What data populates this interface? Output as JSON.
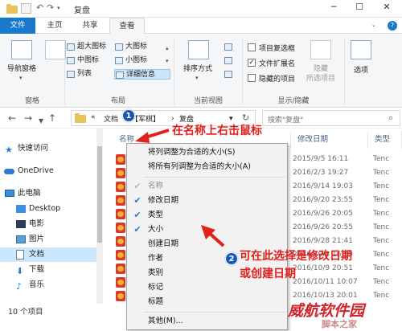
{
  "window": {
    "title": "复盘"
  },
  "ribbon_tabs": [
    {
      "label": "文件"
    },
    {
      "label": "主页"
    },
    {
      "label": "共享"
    },
    {
      "label": "查看"
    }
  ],
  "ribbon": {
    "panes": {
      "nav_pane_label": "导航窗格",
      "group_label": "窗格"
    },
    "layout": {
      "items": [
        "超大图标",
        "大图标",
        "中图标",
        "小图标",
        "列表",
        "详细信息"
      ],
      "group_label": "布局"
    },
    "current_view": {
      "sort_label": "排序方式",
      "group_label": "当前视图"
    },
    "show_hide": {
      "checkboxes": [
        {
          "label": "项目复选框",
          "checked": false
        },
        {
          "label": "文件扩展名",
          "checked": true
        },
        {
          "label": "隐藏的项目",
          "checked": false
        }
      ],
      "hide_selected_label": "隐藏\n所选项目",
      "group_label": "显示/隐藏"
    },
    "options_label": "选项"
  },
  "address": {
    "crumbs": [
      "«",
      "文档",
      "【军棋】",
      "复盘"
    ],
    "search_placeholder": "搜索\"复盘\""
  },
  "sidebar": {
    "items": [
      {
        "label": "快速访问",
        "icon": "star-icon"
      },
      {
        "label": "OneDrive",
        "icon": "cloud-icon"
      },
      {
        "label": "此电脑",
        "icon": "computer-icon"
      },
      {
        "label": "Desktop",
        "icon": "desktop-icon"
      },
      {
        "label": "电影",
        "icon": "movie-icon"
      },
      {
        "label": "图片",
        "icon": "picture-icon"
      },
      {
        "label": "文档",
        "icon": "document-icon"
      },
      {
        "label": "下载",
        "icon": "download-icon"
      },
      {
        "label": "音乐",
        "icon": "music-icon"
      }
    ]
  },
  "filelist": {
    "headers": {
      "name": "名称",
      "date": "修改日期",
      "type": "类型"
    },
    "rows": [
      {
        "date": "2015/9/5 16:11",
        "type": "Tenc"
      },
      {
        "date": "2016/2/3 19:27",
        "type": "Tenc"
      },
      {
        "date": "2016/9/14 19:03",
        "type": "Tenc"
      },
      {
        "date": "2016/9/20 23:55",
        "type": "Tenc"
      },
      {
        "date": "2016/9/26 20:05",
        "type": "Tenc"
      },
      {
        "date": "2016/9/26 20:55",
        "type": "Tenc"
      },
      {
        "date": "2016/9/28 21:41",
        "type": "Tenc"
      },
      {
        "date": "2016/10/8 16:59",
        "type": "Tenc"
      },
      {
        "date": "2016/10/9 20:51",
        "type": "Tenc"
      },
      {
        "date": "2016/10/11 10:07",
        "type": "Tenc"
      },
      {
        "date": "2016/10/13 20:01",
        "type": "Tenc"
      }
    ]
  },
  "status": {
    "count": "10 个项目"
  },
  "context_menu": {
    "items": [
      {
        "label": "将列调整为合适的大小(S)",
        "checked": false,
        "disabled": false
      },
      {
        "label": "将所有列调整为合适的大小(A)",
        "checked": false,
        "disabled": false
      },
      {
        "label": "名称",
        "checked": true,
        "disabled": true
      },
      {
        "label": "修改日期",
        "checked": true,
        "disabled": false
      },
      {
        "label": "类型",
        "checked": true,
        "disabled": false
      },
      {
        "label": "大小",
        "checked": true,
        "disabled": false
      },
      {
        "label": "创建日期",
        "checked": false,
        "disabled": false
      },
      {
        "label": "作者",
        "checked": false,
        "disabled": false
      },
      {
        "label": "类别",
        "checked": false,
        "disabled": false
      },
      {
        "label": "标记",
        "checked": false,
        "disabled": false
      },
      {
        "label": "标题",
        "checked": false,
        "disabled": false
      },
      {
        "label": "其他(M)...",
        "checked": false,
        "disabled": false
      }
    ]
  },
  "annotations": {
    "badge1": "1",
    "badge2": "2",
    "note1": "在名称上右击鼠标",
    "note2_line1": "可在此选择是修改日期",
    "note2_line2": "或创建日期"
  },
  "watermark": {
    "text1": "威航软件园",
    "text2": "脚本之家"
  },
  "colors": {
    "accent": "#1979ca",
    "annotation": "#e0211c",
    "badge": "#1757b8"
  }
}
